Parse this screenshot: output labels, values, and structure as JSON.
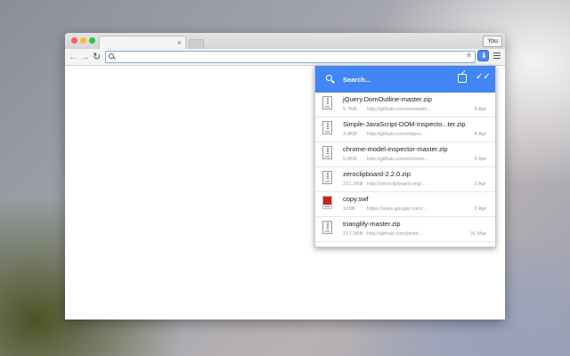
{
  "browser": {
    "profile_label": "You",
    "tab_close": "×",
    "omnibox_value": ""
  },
  "icons": {
    "back": "arrow-left-icon",
    "forward": "arrow-right-icon",
    "reload": "reload-icon",
    "star": "star-icon",
    "extension": "download-icon",
    "menu": "hamburger-menu-icon",
    "popup_search": "search-icon",
    "popup_open": "open-folder-icon",
    "popup_clear": "clear-all-icon"
  },
  "colors": {
    "accent": "#4285f4"
  },
  "popup": {
    "search_placeholder": "Search..."
  },
  "downloads": [
    {
      "name": "jQuery.DomOutline-master.zip",
      "size": "5.7KB",
      "source": "http://github.com/simmalm...",
      "date": "4 Apr",
      "type": "zip"
    },
    {
      "name": "Simple-JavaScript-DOM-Inspecto...ter.zip",
      "size": "3.9KB",
      "source": "http://github.com/oldpro...",
      "date": "4 Apr",
      "type": "zip"
    },
    {
      "name": "chrome-model-inspector-master.zip",
      "size": "5.5KB",
      "source": "http://github.com/chrome...",
      "date": "4 Apr",
      "type": "zip"
    },
    {
      "name": "zeroclipboard-2.2.0.zip",
      "size": "231.3KB",
      "source": "http://zeroclipboard.org/...",
      "date": "2 Apr",
      "type": "zip"
    },
    {
      "name": "copy.swf",
      "size": "109B",
      "source": "https://sites.google.com/...",
      "date": "2 Apr",
      "type": "swf"
    },
    {
      "name": "trianglify-master.zip",
      "size": "217.3KB",
      "source": "http://github.com/prohf...",
      "date": "31 Mar",
      "type": "zip"
    }
  ]
}
